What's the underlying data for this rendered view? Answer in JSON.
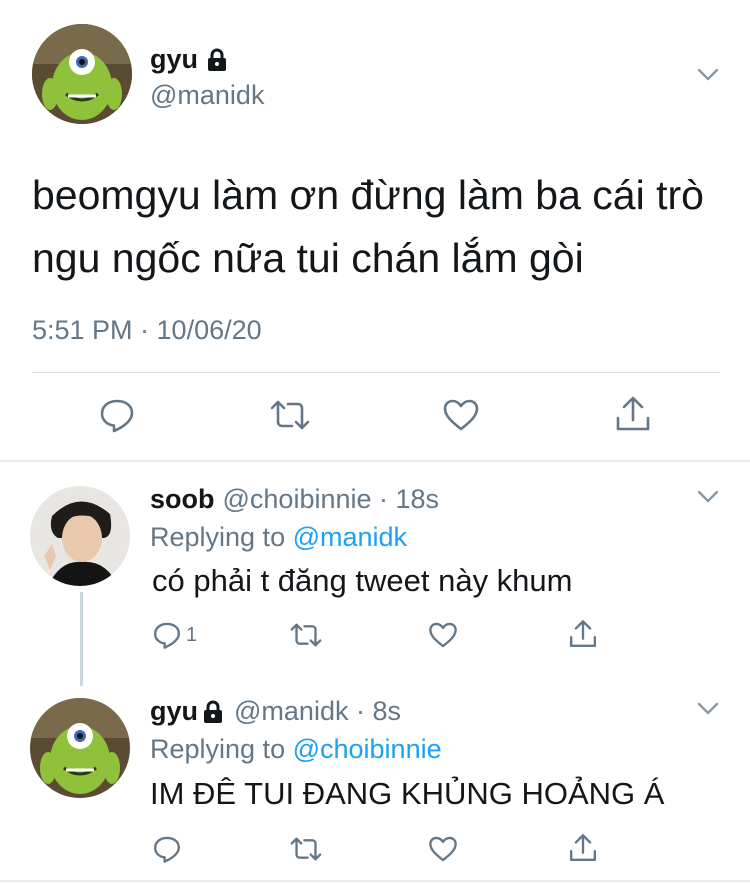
{
  "main_tweet": {
    "name": "gyu",
    "handle": "@manidk",
    "text": "beomgyu làm ơn đừng làm ba cái trò ngu ngốc nữa tui chán lắm gòi",
    "timestamp": "5:51 PM · 10/06/20",
    "icons": [
      "lock-icon",
      "chevron-down-icon",
      "reply-icon",
      "retweet-icon",
      "like-icon",
      "share-icon"
    ]
  },
  "replies": [
    {
      "name": "soob",
      "meta": "@choibinnie · 18s",
      "replying_prefix": "Replying to ",
      "replying_to": "@manidk",
      "text": "có phải t đăng tweet này khum",
      "reply_count": "1"
    },
    {
      "name": "gyu",
      "meta": "@manidk · 8s",
      "replying_prefix": "Replying to ",
      "replying_to": "@choibinnie",
      "text": "IM ĐÊ TUI ĐANG KHỦNG HOẢNG Á",
      "reply_count": ""
    }
  ],
  "colors": {
    "link": "#1da1f2",
    "secondary_text": "#657786",
    "primary_text": "#14171a",
    "divider": "#e6ecf0"
  }
}
